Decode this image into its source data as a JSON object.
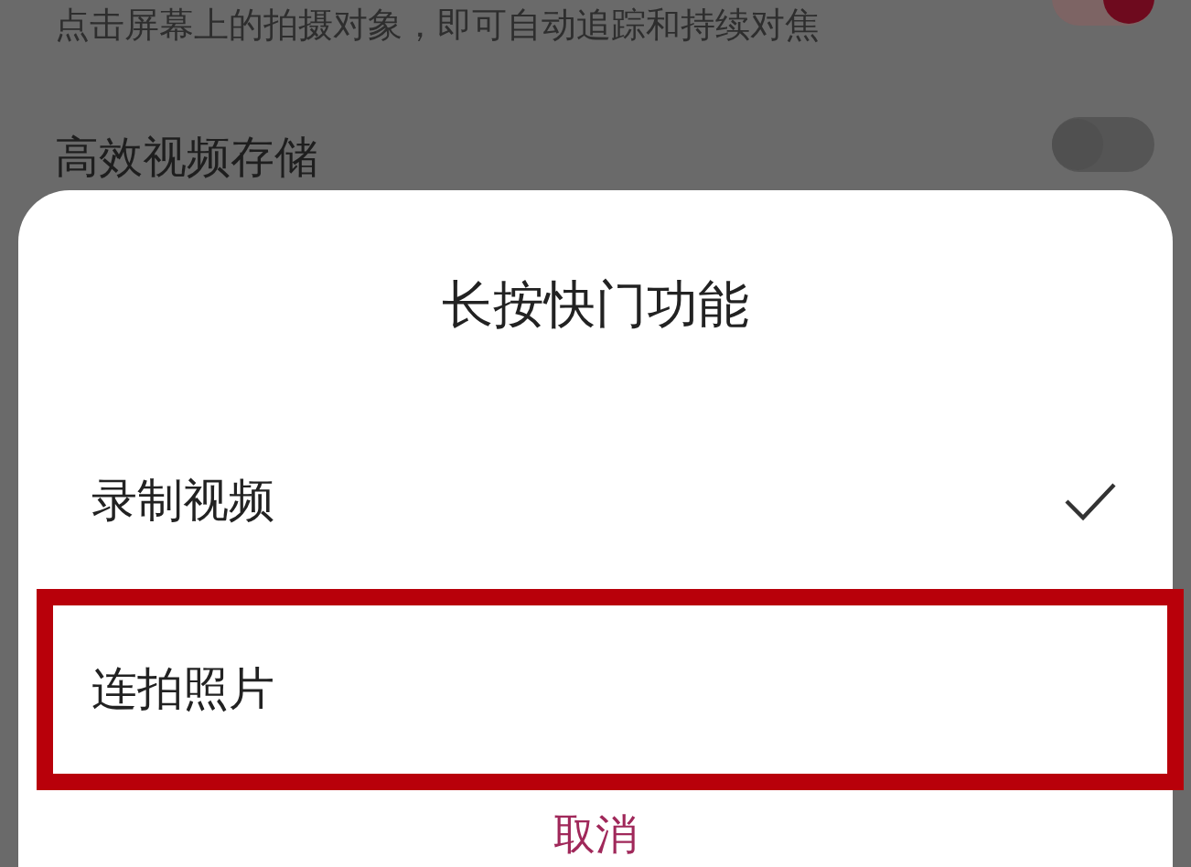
{
  "settings": [
    {
      "kind": "description",
      "text": "点击屏幕上的拍摄对象，即可自动追踪和持续对焦",
      "on": true
    },
    {
      "kind": "title",
      "text": "高效视频存储",
      "on": false
    }
  ],
  "dialog": {
    "title": "长按快门功能",
    "options": [
      {
        "label": "录制视频",
        "selected": true,
        "highlighted": false
      },
      {
        "label": "连拍照片",
        "selected": false,
        "highlighted": true
      }
    ],
    "cancel": "取消"
  }
}
